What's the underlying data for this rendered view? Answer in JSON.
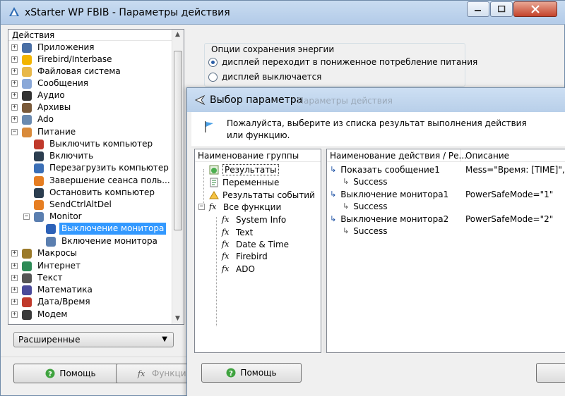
{
  "main_window": {
    "title": "xStarter WP FBIB - Параметры действия",
    "tree": {
      "header": "Действия",
      "items": [
        {
          "label": "Приложения",
          "icon": "monitor-icon"
        },
        {
          "label": "Firebird/Interbase",
          "icon": "firebird-icon"
        },
        {
          "label": "Файловая система",
          "icon": "folder-icon"
        },
        {
          "label": "Сообщения",
          "icon": "message-icon"
        },
        {
          "label": "Аудио",
          "icon": "speaker-icon"
        },
        {
          "label": "Архивы",
          "icon": "archive-icon"
        },
        {
          "label": "Ado",
          "icon": "database-icon"
        },
        {
          "label": "Питание",
          "icon": "power-folder-icon"
        },
        {
          "label": "Выключить компьютер",
          "icon": "shutdown-icon"
        },
        {
          "label": "Включить",
          "icon": "power-on-icon"
        },
        {
          "label": "Перезагрузить компьютер",
          "icon": "restart-icon"
        },
        {
          "label": "Завершение сеанса поль...",
          "icon": "logoff-icon"
        },
        {
          "label": "Остановить компьютер",
          "icon": "standby-icon"
        },
        {
          "label": "SendCtrlAltDel",
          "icon": "keys-icon"
        },
        {
          "label": "Monitor",
          "icon": "monitor-folder-icon"
        },
        {
          "label": "Выключение монитора",
          "icon": "monitor-off-icon"
        },
        {
          "label": "Включение монитора",
          "icon": "monitor-on-icon"
        },
        {
          "label": "Макросы",
          "icon": "macro-icon"
        },
        {
          "label": "Интернет",
          "icon": "globe-icon"
        },
        {
          "label": "Текст",
          "icon": "text-icon"
        },
        {
          "label": "Математика",
          "icon": "math-icon"
        },
        {
          "label": "Дата/Время",
          "icon": "calendar-icon"
        },
        {
          "label": "Модем",
          "icon": "modem-icon"
        }
      ]
    },
    "mode_select": {
      "value": "Расширенные"
    },
    "help_button": "Помощь",
    "functions_button": "Функци",
    "energy": {
      "legend": "Опции сохранения энергии",
      "option1": "дисплей переходит в пониженное потребление питания",
      "option2": "дисплей выключается"
    }
  },
  "dialog": {
    "title": "Выбор параметра",
    "ghost_title": "Параметры действия",
    "info": "Пожалуйста, выберите из списка результат выполнения действия или функцию.",
    "groups": {
      "header": "Наименование группы",
      "items": {
        "results": "Результаты",
        "variables": "Переменные",
        "event_results": "Результаты событий",
        "all_functions": "Все функции",
        "system_info": "System Info",
        "text": "Text",
        "datetime": "Date & Time",
        "firebird": "Firebird",
        "ado": "ADO"
      }
    },
    "actions": {
      "header_name": "Наименование действия / Ре...",
      "header_desc": "Описание",
      "rows": [
        {
          "name": "Показать сообщение1",
          "desc": "Mess=\"Время: [TIME]\", I",
          "child": "Success"
        },
        {
          "name": "Выключение монитора1",
          "desc": "PowerSafeMode=\"1\"",
          "child": "Success"
        },
        {
          "name": "Выключение монитора2",
          "desc": "PowerSafeMode=\"2\"",
          "child": "Success"
        }
      ]
    },
    "help_button": "Помощь"
  }
}
